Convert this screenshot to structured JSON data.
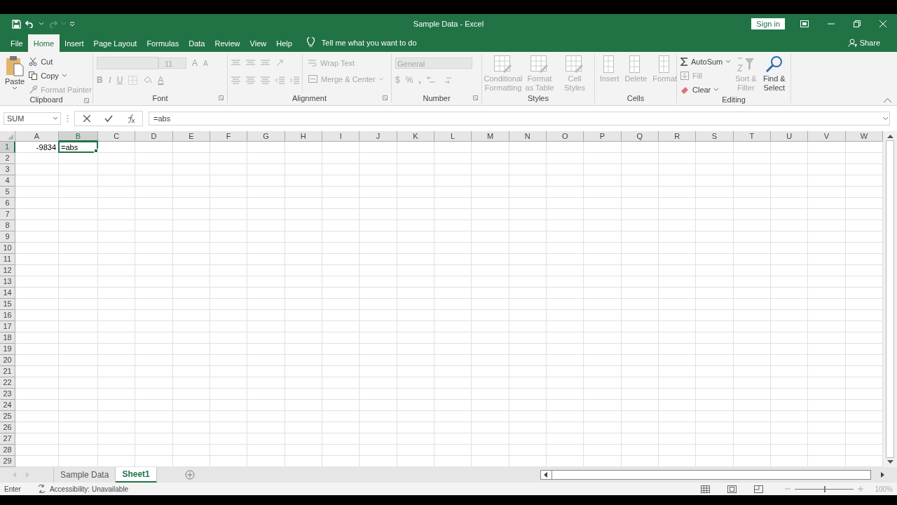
{
  "window": {
    "title": "Sample Data  -  Excel",
    "sign_in": "Sign in"
  },
  "tabs": [
    {
      "label": "File",
      "selected": false
    },
    {
      "label": "Home",
      "selected": true
    },
    {
      "label": "Insert",
      "selected": false
    },
    {
      "label": "Page Layout",
      "selected": false
    },
    {
      "label": "Formulas",
      "selected": false
    },
    {
      "label": "Data",
      "selected": false
    },
    {
      "label": "Review",
      "selected": false
    },
    {
      "label": "View",
      "selected": false
    },
    {
      "label": "Help",
      "selected": false
    }
  ],
  "tell_me": "Tell me what you want to do",
  "share": "Share",
  "ribbon": {
    "clipboard": {
      "label": "Clipboard",
      "paste": {
        "label": "Paste",
        "disabled": false
      },
      "cut": {
        "label": "Cut",
        "disabled": false
      },
      "copy": {
        "label": "Copy",
        "disabled": false
      },
      "format_painter": {
        "label": "Format Painter",
        "disabled": true
      }
    },
    "font": {
      "label": "Font",
      "disabled": true,
      "size": "11",
      "grow": "A",
      "shrink": "A",
      "bold": "B",
      "italic": "I",
      "underline": "U",
      "font_color": "A"
    },
    "alignment": {
      "label": "Alignment",
      "disabled": true,
      "wrap_text": "Wrap Text",
      "merge": "Merge & Center"
    },
    "number": {
      "label": "Number",
      "disabled": true,
      "format": "General",
      "currency": "$",
      "percent": "%",
      "comma": ","
    },
    "styles": {
      "label": "Styles",
      "disabled": true,
      "buttons": [
        "Conditional Formatting",
        "Format as Table",
        "Cell Styles"
      ]
    },
    "cells": {
      "label": "Cells",
      "disabled": true,
      "buttons": [
        "Insert",
        "Delete",
        "Format"
      ]
    },
    "editing": {
      "label": "Editing",
      "autosum": {
        "label": "AutoSum",
        "disabled": false
      },
      "fill": {
        "label": "Fill",
        "disabled": true
      },
      "clear": {
        "label": "Clear",
        "disabled": false
      },
      "sort": {
        "label": "Sort & Filter",
        "disabled": true
      },
      "find": {
        "label": "Find & Select",
        "disabled": false
      }
    }
  },
  "formula_bar": {
    "name_box": "SUM",
    "formula": "=abs"
  },
  "grid": {
    "columns": [
      {
        "label": "A",
        "selected": false
      },
      {
        "label": "B",
        "selected": true
      },
      {
        "label": "C",
        "selected": false
      },
      {
        "label": "D",
        "selected": false
      },
      {
        "label": "E",
        "selected": false
      },
      {
        "label": "F",
        "selected": false
      },
      {
        "label": "G",
        "selected": false
      },
      {
        "label": "H",
        "selected": false
      },
      {
        "label": "I",
        "selected": false
      },
      {
        "label": "J",
        "selected": false
      },
      {
        "label": "K",
        "selected": false
      },
      {
        "label": "L",
        "selected": false
      },
      {
        "label": "M",
        "selected": false
      },
      {
        "label": "N",
        "selected": false
      },
      {
        "label": "O",
        "selected": false
      },
      {
        "label": "P",
        "selected": false
      },
      {
        "label": "Q",
        "selected": false
      },
      {
        "label": "R",
        "selected": false
      },
      {
        "label": "S",
        "selected": false
      },
      {
        "label": "T",
        "selected": false
      },
      {
        "label": "U",
        "selected": false
      },
      {
        "label": "V",
        "selected": false
      },
      {
        "label": "W",
        "selected": false
      }
    ],
    "rows": [
      {
        "label": "1",
        "selected": true,
        "cells": [
          {
            "value": "-9834",
            "kind": "number",
            "selected": false
          },
          {
            "value": "=abs",
            "kind": "text",
            "selected": true
          }
        ]
      },
      {
        "label": "2",
        "selected": false
      },
      {
        "label": "3",
        "selected": false
      },
      {
        "label": "4",
        "selected": false
      },
      {
        "label": "5",
        "selected": false
      },
      {
        "label": "6",
        "selected": false
      },
      {
        "label": "7",
        "selected": false
      },
      {
        "label": "8",
        "selected": false
      },
      {
        "label": "9",
        "selected": false
      },
      {
        "label": "10",
        "selected": false
      },
      {
        "label": "11",
        "selected": false
      },
      {
        "label": "12",
        "selected": false
      },
      {
        "label": "13",
        "selected": false
      },
      {
        "label": "14",
        "selected": false
      },
      {
        "label": "15",
        "selected": false
      },
      {
        "label": "16",
        "selected": false
      },
      {
        "label": "17",
        "selected": false
      },
      {
        "label": "18",
        "selected": false
      },
      {
        "label": "19",
        "selected": false
      },
      {
        "label": "20",
        "selected": false
      },
      {
        "label": "21",
        "selected": false
      },
      {
        "label": "22",
        "selected": false
      },
      {
        "label": "23",
        "selected": false
      },
      {
        "label": "24",
        "selected": false
      },
      {
        "label": "25",
        "selected": false
      },
      {
        "label": "26",
        "selected": false
      },
      {
        "label": "27",
        "selected": false
      },
      {
        "label": "28",
        "selected": false
      },
      {
        "label": "29",
        "selected": false
      }
    ]
  },
  "sheets": [
    {
      "label": "Sample Data",
      "selected": false
    },
    {
      "label": "Sheet1",
      "selected": true
    }
  ],
  "status_bar": {
    "mode": "Enter",
    "accessibility": "Accessibility: Unavailable",
    "zoom": {
      "level": 0.5,
      "reading": "100%"
    }
  }
}
